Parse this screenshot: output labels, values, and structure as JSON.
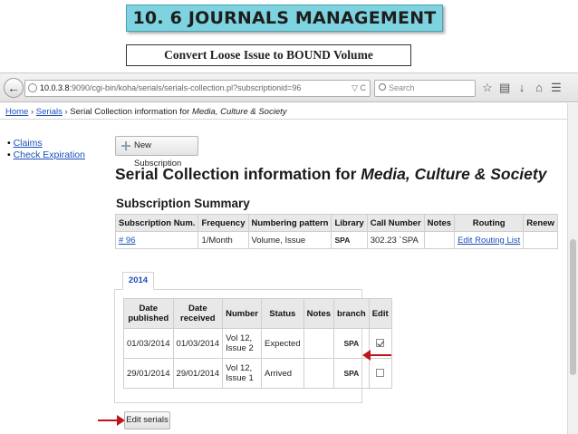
{
  "slide": {
    "title": "10. 6 JOURNALS MANAGEMENT",
    "subtitle": "Convert Loose Issue  to BOUND Volume"
  },
  "browser": {
    "url_host": "10.0.3.8",
    "url_rest": ":9090/cgi-bin/koha/serials/serials-collection.pl?subscriptionid=96",
    "search_placeholder": "Search"
  },
  "breadcrumb": {
    "home": "Home",
    "serials": "Serials",
    "current_prefix": "Serial Collection information for ",
    "current_title": "Media, Culture & Society"
  },
  "left_menu": {
    "claims": "Claims",
    "check_expiration": "Check Expiration"
  },
  "new_subscription_label": "New Subscription",
  "heading": {
    "prefix": "Serial Collection information for ",
    "title": "Media, Culture & Society"
  },
  "subscription_summary": {
    "heading": "Subscription Summary",
    "columns": [
      "Subscription Num.",
      "Frequency",
      "Numbering pattern",
      "Library",
      "Call Number",
      "Notes",
      "Routing",
      "Renew"
    ],
    "row": {
      "num": "# 96",
      "frequency": "1/Month",
      "pattern": "Volume, Issue",
      "library": "SPA",
      "call_number": "302.23 `SPA",
      "notes": "",
      "routing": "Edit Routing List",
      "renew": ""
    }
  },
  "issues": {
    "year_tab": "2014",
    "columns": {
      "published": [
        "Date",
        "published"
      ],
      "received": [
        "Date",
        "received"
      ],
      "number": "Number",
      "status": "Status",
      "notes": "Notes",
      "branch": "branch",
      "edit": "Edit"
    },
    "rows": [
      {
        "published": "01/03/2014",
        "received": "01/03/2014",
        "number": [
          "Vol 12,",
          "Issue 2"
        ],
        "status": "Expected",
        "notes": "",
        "branch": "SPA",
        "checked": true
      },
      {
        "published": "29/01/2014",
        "received": "29/01/2014",
        "number": [
          "Vol 12,",
          "Issue 1"
        ],
        "status": "Arrived",
        "notes": "",
        "branch": "SPA",
        "checked": false
      }
    ]
  },
  "edit_serials_label": "Edit serials",
  "colors": {
    "title_bg": "#7ed3e0",
    "link": "#1a4eb8",
    "arrow": "#c0141b"
  }
}
